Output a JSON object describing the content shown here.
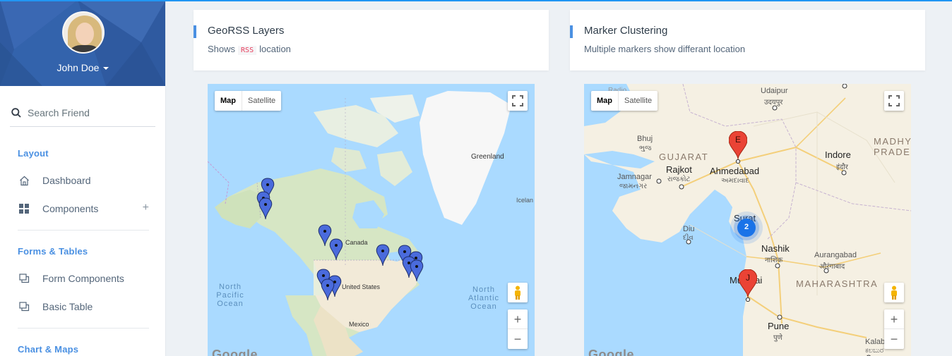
{
  "user": {
    "name": "John Doe"
  },
  "search": {
    "placeholder": "Search Friend"
  },
  "sidebar": {
    "sections": [
      {
        "heading": "Layout",
        "items": [
          {
            "label": "Dashboard",
            "icon": "home-icon"
          },
          {
            "label": "Components",
            "icon": "grid-icon",
            "expand": "+"
          }
        ]
      },
      {
        "heading": "Forms & Tables",
        "items": [
          {
            "label": "Form Components",
            "icon": "copy-icon"
          },
          {
            "label": "Basic Table",
            "icon": "copy-icon"
          }
        ]
      },
      {
        "heading": "Chart & Maps",
        "items": []
      }
    ]
  },
  "cards": [
    {
      "title": "GeoRSS Layers",
      "subtitle_pre": "Shows",
      "subtitle_code": "RSS",
      "subtitle_post": "location",
      "map": {
        "controls": {
          "map": "Map",
          "satellite": "Satellite",
          "zoom_in": "+",
          "zoom_out": "−"
        },
        "labels": {
          "greenland": "Greenland",
          "iceland": "Icelan",
          "canada": "Canada",
          "usa": "United States",
          "mexico": "Mexico",
          "pacific": "North Pacific Ocean",
          "atlantic": "North Atlantic Ocean",
          "google": "Google"
        },
        "pin_color": "#4a6bdc"
      }
    },
    {
      "title": "Marker Clustering",
      "subtitle": "Multiple markers show differant location",
      "map": {
        "controls": {
          "map": "Map",
          "satellite": "Satellite",
          "zoom_in": "+",
          "zoom_out": "−"
        },
        "labels": {
          "radio": "Radio",
          "udaipur": "Udaipur",
          "udaipur_local": "उदयपुर",
          "bhuj": "Bhuj",
          "bhuj_local": "ભુજ",
          "gujarat": "GUJARAT",
          "indore": "Indore",
          "indore_local": "इंदौर",
          "madhya": "MADHYA",
          "pradesh": "PRADESH",
          "rajkot": "Rajkot",
          "rajkot_local": "રાજકોટ",
          "ahmedabad": "Ahmedabad",
          "ahmedabad_local": "અમદાવાદ",
          "jamnagar": "Jamnagar",
          "jamnagar_local": "જામનગર",
          "surat": "Surat",
          "diu": "Diu",
          "diu_local": "દીવ",
          "nashik": "Nashik",
          "nashik_local": "नाशिक",
          "aurangabad": "Aurangabad",
          "aurangabad_local": "औरंगाबाद",
          "mumbai": "Mumbai",
          "maharashtra": "MAHARASHTRA",
          "pune": "Pune",
          "pune_local": "पुणे",
          "kalaburagi": "Kalabur",
          "kalaburagi_local": "ಕಲಬುರ",
          "google": "Google"
        },
        "markers": [
          {
            "letter": "E"
          },
          {
            "letter": "J"
          }
        ],
        "cluster": {
          "count": "2"
        },
        "marker_color": "#ea4335",
        "cluster_color": "#1a73e8"
      }
    }
  ]
}
